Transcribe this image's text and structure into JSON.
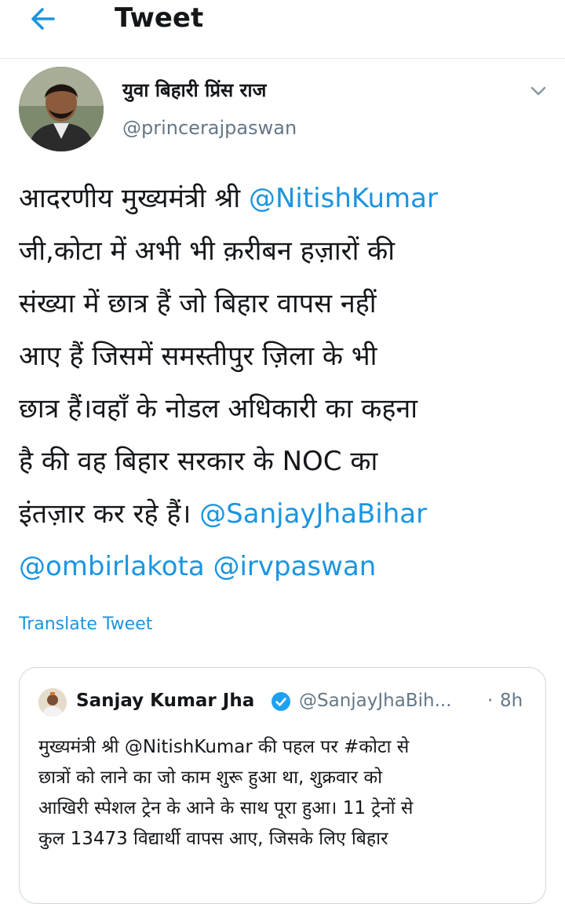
{
  "header": {
    "back_icon": "arrow-left-icon",
    "title": "Tweet"
  },
  "tweet": {
    "display_name": "युवा बिहारी प्रिंस राज",
    "handle": "@princerajpaswan",
    "menu_icon": "chevron-down-icon",
    "lines": [
      {
        "pre": "आदरणीय मुख्यमंत्री श्री ",
        "mention": "@NitishKumar",
        "post": ""
      },
      {
        "pre": "जी,कोटा में अभी भी क़रीबन हज़ारों की",
        "mention": "",
        "post": ""
      },
      {
        "pre": "संख्या में छात्र हैं जो बिहार वापस नहीं",
        "mention": "",
        "post": ""
      },
      {
        "pre": "आए हैं जिसमें समस्तीपुर ज़िला के भी",
        "mention": "",
        "post": ""
      },
      {
        "pre": "छात्र हैं।वहाँ के नोडल अधिकारी का कहना",
        "mention": "",
        "post": ""
      },
      {
        "pre": "है की वह बिहार सरकार के NOC का",
        "mention": "",
        "post": ""
      },
      {
        "pre": "इंतज़ार कर रहे हैं। ",
        "mention": "@SanjayJhaBihar",
        "post": ""
      },
      {
        "pre": "",
        "mention": "@ombirlakota",
        "post": " ",
        "mention2": "@irvpaswan"
      }
    ],
    "translate_label": "Translate Tweet"
  },
  "quoted": {
    "name": "Sanjay Kumar Jha",
    "verified_icon": "verified-badge-icon",
    "handle": "@SanjayJhaBih...",
    "dot": "·",
    "time": "8h",
    "lines": [
      "मुख्यमंत्री श्री @NitishKumar की पहल पर #कोटा से",
      "छात्रों को लाने का जो काम शुरू हुआ था, शुक्रवार को",
      "आखिरी स्पेशल ट्रेन के आने के साथ पूरा हुआ। 11 ट्रेनों से",
      "कुल 13473 विद्यार्थी वापस आए, जिसके लिए बिहार"
    ]
  },
  "colors": {
    "accent": "#1b95e0",
    "text": "#14171a",
    "muted": "#657786",
    "border": "#e1e8ed"
  }
}
